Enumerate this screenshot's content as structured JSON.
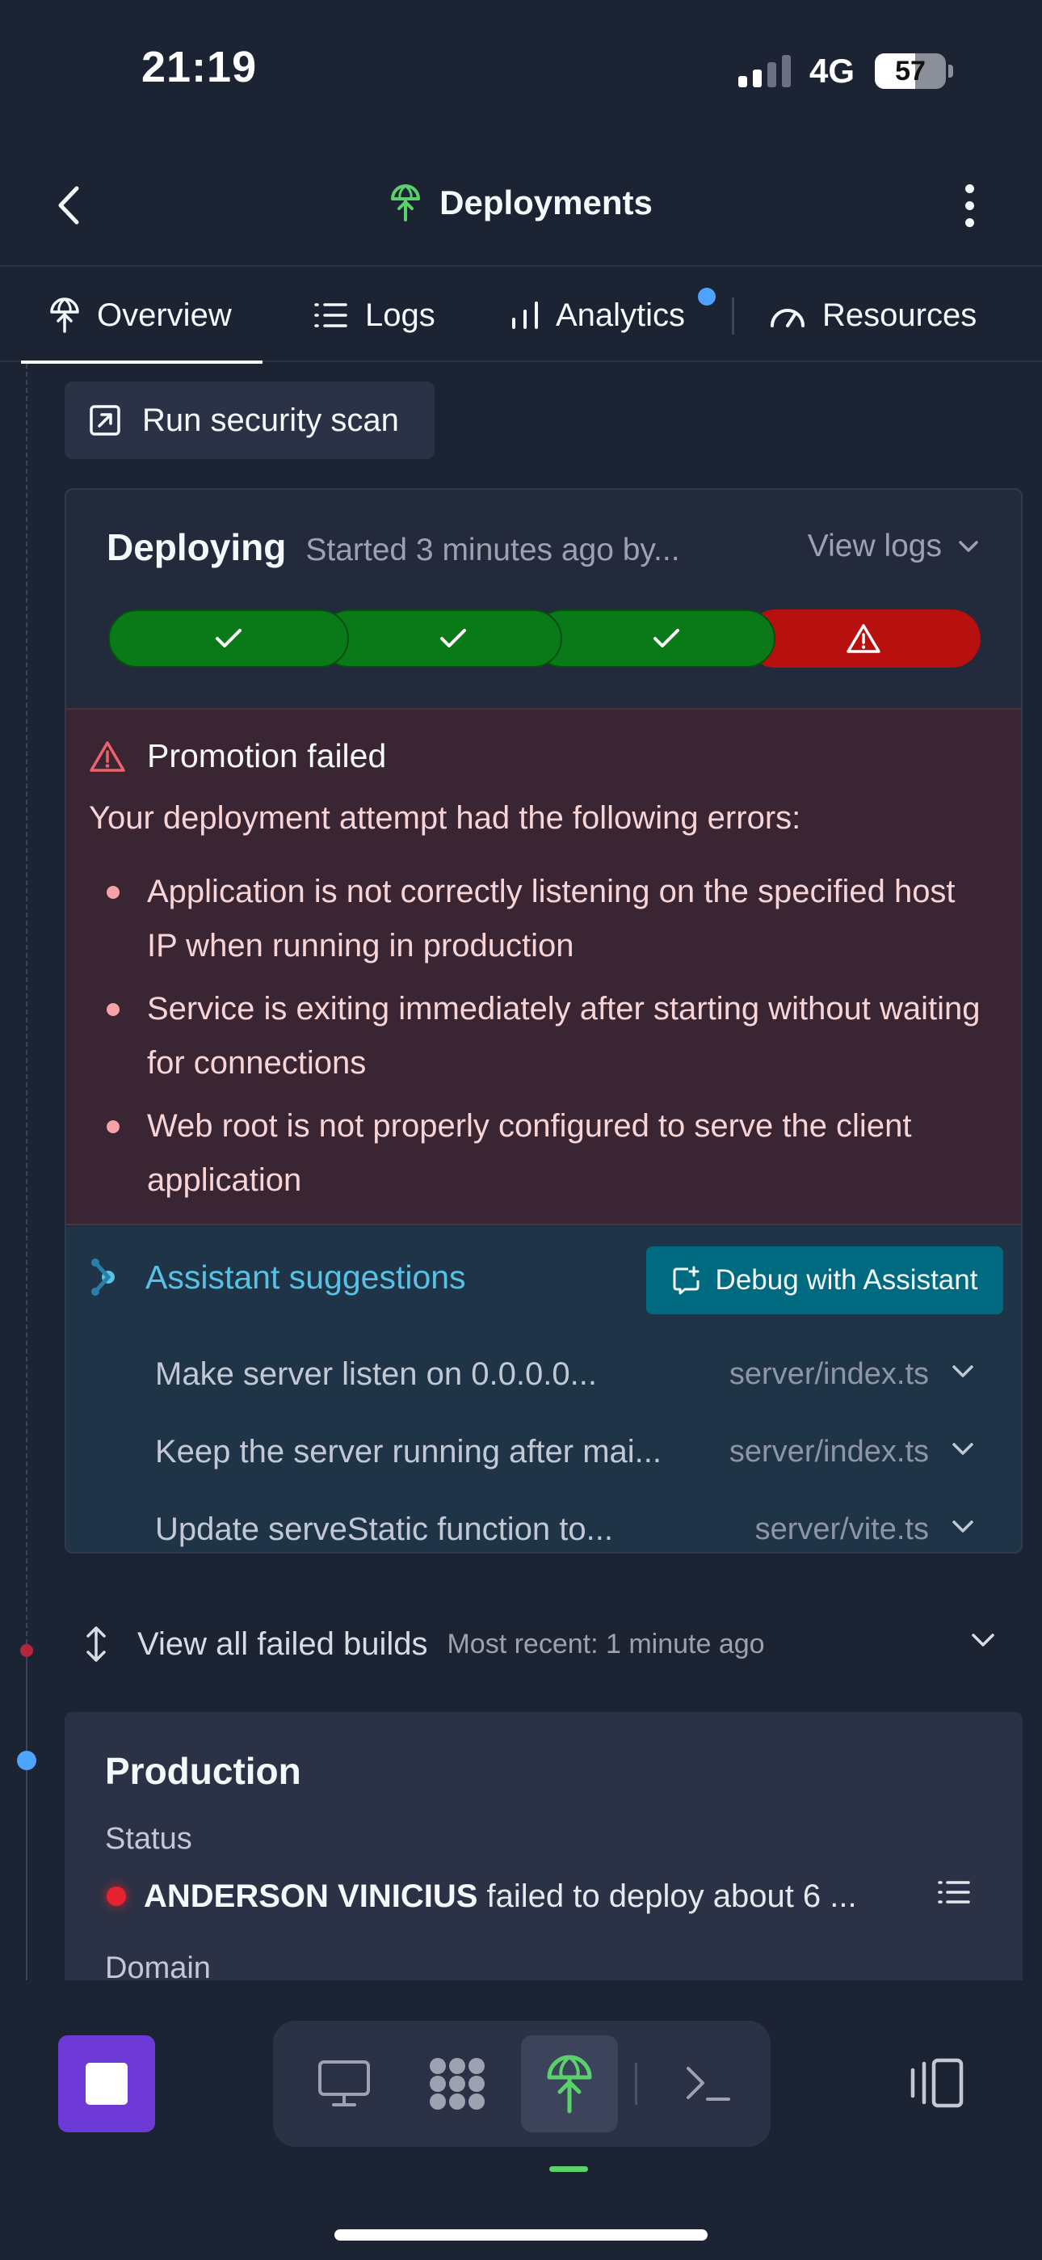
{
  "status_bar": {
    "time": "21:19",
    "network": "4G",
    "battery": "57",
    "battery_level": 0.57
  },
  "header": {
    "title": "Deployments",
    "icons": {
      "back": "chevron-left-icon",
      "title": "deployments-icon",
      "more": "more-vertical-icon"
    }
  },
  "tabs": [
    {
      "label": "Overview",
      "icon": "deployments-icon",
      "active": true
    },
    {
      "label": "Logs",
      "icon": "list-icon"
    },
    {
      "label": "Analytics",
      "icon": "bar-chart-icon",
      "notification": true
    },
    {
      "label": "Resources",
      "icon": "gauge-icon"
    }
  ],
  "scan_button": {
    "label": "Run security scan",
    "icon": "external-link-icon"
  },
  "deployment": {
    "status": "Deploying",
    "subtitle": "Started 3 minutes ago by...",
    "view_logs": "View logs",
    "steps": [
      "success",
      "success",
      "success",
      "error"
    ],
    "colors": {
      "success": "#0a7a18",
      "error": "#b80f0f"
    },
    "error": {
      "title": "Promotion failed",
      "intro": "Your deployment attempt had the following errors:",
      "items": [
        "Application is not correctly listening on the specified host IP when running in production",
        "Service is exiting immediately after starting without waiting for connections",
        "Web root is not properly configured to serve the client application"
      ]
    },
    "assistant": {
      "title": "Assistant suggestions",
      "debug_button": "Debug with Assistant",
      "suggestions": [
        {
          "text": "Make server listen on 0.0.0.0...",
          "file": "server/index.ts"
        },
        {
          "text": "Keep the server running after mai...",
          "file": "server/index.ts"
        },
        {
          "text": "Update serveStatic function to...",
          "file": "server/vite.ts"
        }
      ]
    }
  },
  "failed_builds": {
    "label": "View all failed builds",
    "meta": "Most recent: 1 minute ago"
  },
  "production": {
    "title": "Production",
    "status_label": "Status",
    "status_user": "ANDERSON VINICIUS",
    "status_text": "failed to deploy about 6 ...",
    "domain_label": "Domain"
  },
  "bottom_bar": {
    "dock": [
      "monitor-icon",
      "apps-grid-icon",
      "deployments-icon",
      "terminal-icon"
    ],
    "active_dock_item": "deployments-icon"
  }
}
